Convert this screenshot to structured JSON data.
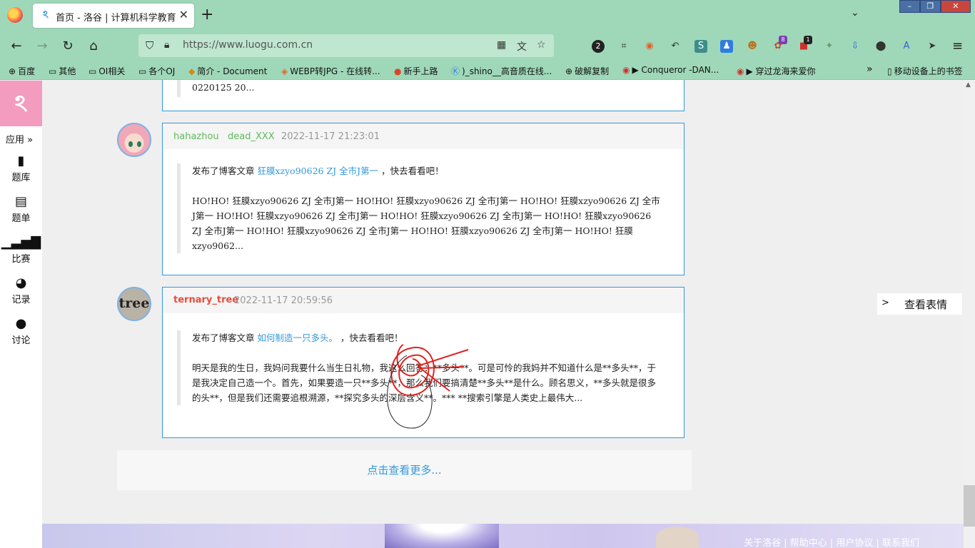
{
  "browser": {
    "tab_title": "首页 - 洛谷 | 计算机科学教育新",
    "url": "https://www.luogu.com.cn",
    "bookmarks": [
      {
        "icon": "globe-icon",
        "label": "百度"
      },
      {
        "icon": "folder-icon",
        "label": "其他"
      },
      {
        "icon": "folder-icon",
        "label": "OI相关"
      },
      {
        "icon": "folder-icon",
        "label": "各个OJ"
      },
      {
        "icon": "doc-icon",
        "label": "简介 - Document"
      },
      {
        "icon": "image-icon",
        "label": "WEBP转JPG - 在线转..."
      },
      {
        "icon": "dot-icon",
        "label": "新手上路"
      },
      {
        "icon": "k-icon",
        "label": ")_shino__高音质在线..."
      },
      {
        "icon": "globe-icon",
        "label": "破解复制"
      },
      {
        "icon": "music-icon",
        "label": "▶ Conqueror -DAN..."
      },
      {
        "icon": "music-icon",
        "label": "▶ 穿过龙海来爱你"
      }
    ],
    "bookmarks_overflow": "»",
    "mobile_bookmarks": "移动设备上的书签",
    "ext_badges": {
      "ext1": "2",
      "ext2": "8",
      "ext3": "1"
    }
  },
  "sidebar": {
    "apps_label": "应用 »",
    "items": [
      {
        "icon": "book-icon",
        "label": "题库"
      },
      {
        "icon": "clipboard-icon",
        "label": "题单"
      },
      {
        "icon": "bars-icon",
        "label": "比赛"
      },
      {
        "icon": "pie-icon",
        "label": "记录"
      },
      {
        "icon": "chat-icon",
        "label": "讨论"
      }
    ]
  },
  "feed": {
    "prev_snippet": "0220125 20...",
    "posts": [
      {
        "user": "hahazhou",
        "extra": "dead_XXX",
        "time": "2022-11-17 21:23:01",
        "action_prefix": "发布了博客文章 ",
        "article": "狂膜xzyo90626 ZJ 全市J第一",
        "action_suffix": " ，快去看看吧！",
        "excerpt": "HO!HO! 狂膜xzyo90626 ZJ 全市J第一 HO!HO! 狂膜xzyo90626 ZJ 全市J第一 HO!HO! 狂膜xzyo90626 ZJ 全市J第一 HO!HO! 狂膜xzyo90626 ZJ 全市J第一 HO!HO! 狂膜xzyo90626 ZJ 全市J第一 HO!HO! 狂膜xzyo90626 ZJ 全市J第一 HO!HO! 狂膜xzyo90626 ZJ 全市J第一 HO!HO! 狂膜xzyo90626 ZJ 全市J第一 HO!HO! 狂膜xzyo9062..."
      },
      {
        "user": "ternary_tree",
        "avatar_text": "tree",
        "time": "2022-11-17 20:59:56",
        "action_prefix": "发布了博客文章 ",
        "article": "如何制造一只多头。",
        "action_suffix": " ，快去看看吧！",
        "excerpt": "明天是我的生日，我妈问我要什么当生日礼物，我这么回答：**多头**。可是可怜的我妈并不知道什么是**多头**，于是我决定自己造一个。首先，如果要造一只**多头**，那么我们要搞清楚**多头**是什么。顾名思义，**多头就是很多的头**，但是我们还需要追根溯源，**探究多头的深层含义**。*** **搜索引擎是人类史上最伟大..."
      }
    ],
    "load_more": "点击查看更多..."
  },
  "emoji_button": {
    "arrow": ">",
    "label": "查看表情"
  },
  "footer_links": "关于洛谷 | 帮助中心 | 用户协议 | 联系我们"
}
